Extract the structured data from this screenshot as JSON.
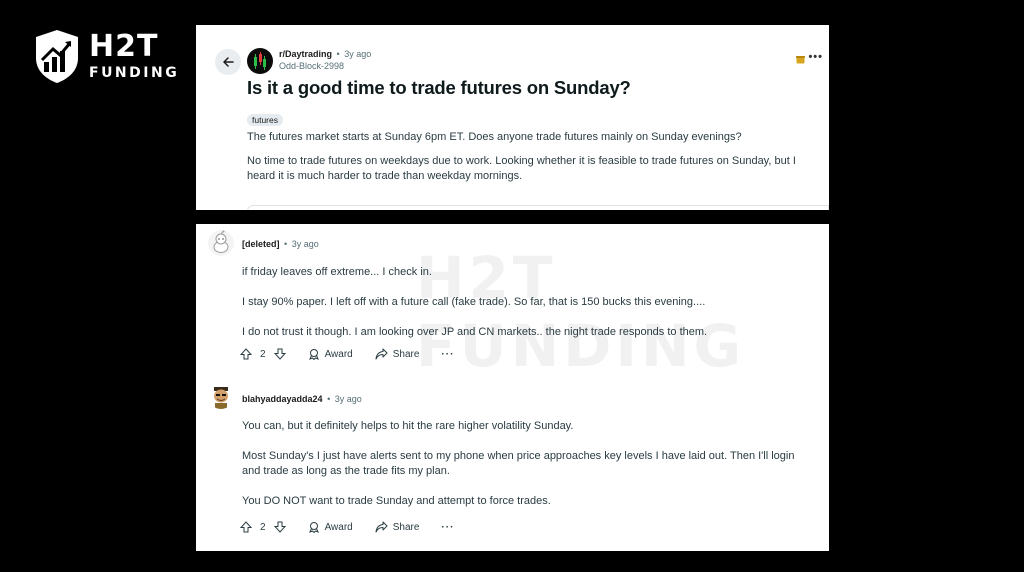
{
  "brand": {
    "name": "H2T",
    "subtitle": "FUNDING"
  },
  "post": {
    "subreddit": "r/Daytrading",
    "time": "3y ago",
    "author": "Odd-Block-2998",
    "title": "Is it a good time to trade futures on Sunday?",
    "flair": "futures",
    "body": [
      "The futures market starts at Sunday 6pm ET. Does anyone trade futures mainly on Sunday evenings?",
      "No time to trade futures on weekdays due to work. Looking whether it is feasible to trade futures on Sunday, but I heard it is much harder to trade than weekday mornings."
    ]
  },
  "watermark": "H2T FUNDING",
  "comments": [
    {
      "user": "[deleted]",
      "time": "3y ago",
      "body": [
        "if friday leaves off extreme... I check in.",
        "I stay 90% paper. I left off with a future call (fake trade). So far, that is 150 bucks this evening....",
        "I do not trust it though. I am looking over JP and CN markets.. the night trade responds to them."
      ],
      "votes": "2",
      "award_label": "Award",
      "share_label": "Share"
    },
    {
      "user": "blahyaddayadda24",
      "time": "3y ago",
      "body": [
        "You can, but it definitely helps to hit the rare higher volatility Sunday.",
        "Most Sunday's I just have alerts sent to my phone when price approaches key levels I have laid out. Then I'll login and trade as long as the trade fits my plan.",
        "You DO NOT want to trade Sunday and attempt to force trades."
      ],
      "votes": "2",
      "award_label": "Award",
      "share_label": "Share"
    }
  ],
  "icons": {
    "back": "arrow-left-icon",
    "more": "ellipsis-icon",
    "upvote": "arrow-up-icon",
    "downvote": "arrow-down-icon",
    "award": "award-icon",
    "share": "share-icon"
  },
  "colors": {
    "background": "#000000",
    "card": "#ffffff",
    "meta_text": "#576f76",
    "flair_bg": "#e5ebee"
  }
}
